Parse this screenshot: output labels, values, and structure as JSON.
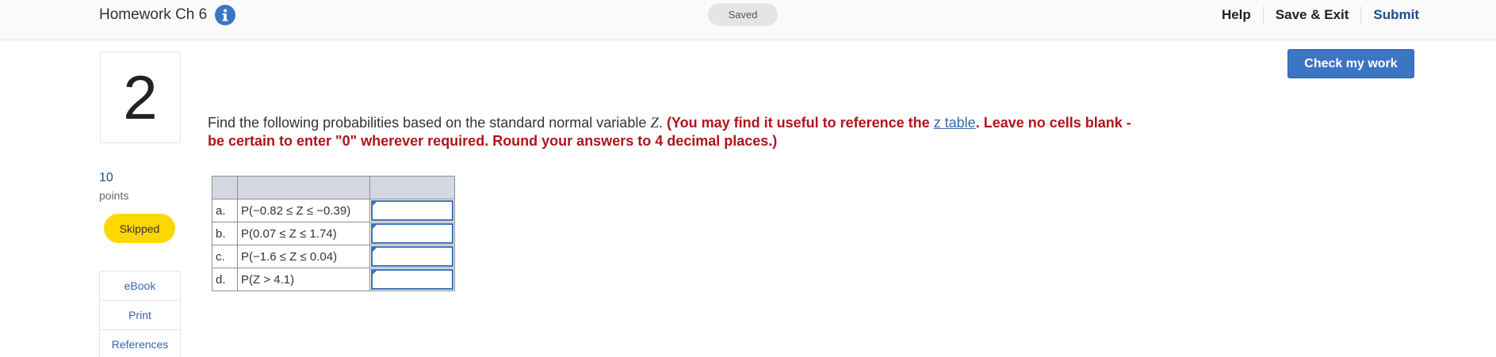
{
  "header": {
    "assignment_title": "Homework Ch 6",
    "status": "Saved",
    "help_label": "Help",
    "save_exit_label": "Save & Exit",
    "submit_label": "Submit"
  },
  "question": {
    "number": "2",
    "points_value": "10",
    "points_label": "points",
    "status_badge": "Skipped",
    "text_before": "Find the following probabilities based on the standard normal variable ",
    "variable": "Z",
    "text_after": ". ",
    "instruction_start": "(You may find it useful to reference the ",
    "link_text": "z table",
    "instruction_end": ". Leave no cells blank - be certain to enter \"0\" wherever required. Round your answers to 4 decimal places.)"
  },
  "actions": {
    "check_my_work_label": "Check my work"
  },
  "resources": [
    "eBook",
    "Print",
    "References"
  ],
  "answers_table": {
    "rows": [
      {
        "letter": "a.",
        "label": "P(−0.82 ≤ Z ≤ −0.39)",
        "value": ""
      },
      {
        "letter": "b.",
        "label": "P(0.07 ≤ Z ≤ 1.74)",
        "value": ""
      },
      {
        "letter": "c.",
        "label": "P(−1.6 ≤ Z ≤ 0.04)",
        "value": ""
      },
      {
        "letter": "d.",
        "label": "P(Z > 4.1)",
        "value": ""
      }
    ]
  },
  "colors": {
    "accent_blue": "#3d75c5",
    "instruction_red": "#b0141b",
    "skipped_yellow": "#fcd800",
    "table_header": "#d4d8e2"
  },
  "icons": {
    "info": "info-icon"
  }
}
